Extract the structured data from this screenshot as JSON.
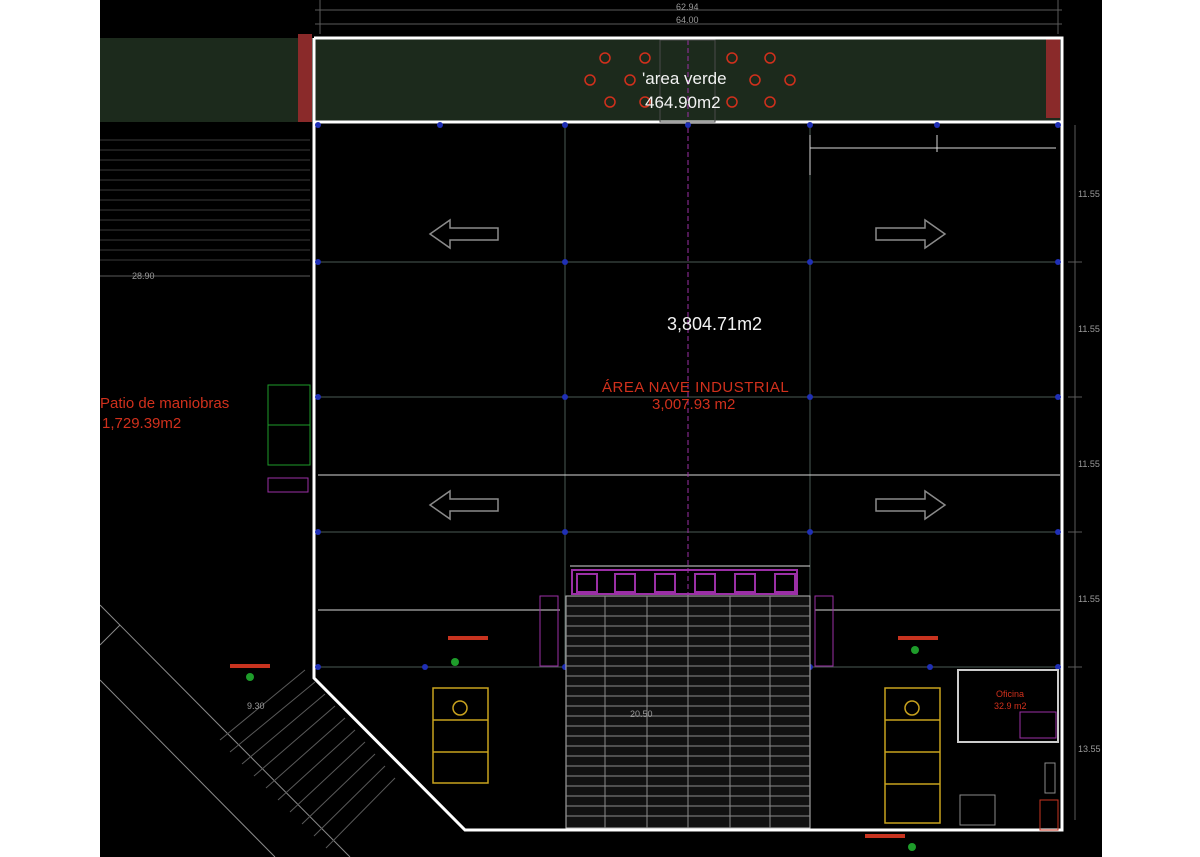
{
  "drawing": {
    "colors": {
      "background": "#000000",
      "boundary": "#ffffff",
      "area_label": "#f2f2f2",
      "annotation": "#d1301c",
      "column_marker": "#1f2fb5",
      "dock_door": "#9b2fa6",
      "grid_line": "#4a5a55",
      "green_strip": "#1c2a1c",
      "brick": "#8a2a2a",
      "dimension_text": "#9a9a9a"
    },
    "labels": {
      "green_area_name": "'area verde",
      "green_area_value": "464.90m2",
      "main_area_value": "3,804.71m2",
      "nave_name": "ÁREA NAVE INDUSTRIAL",
      "nave_value": "3,007.93 m2",
      "patio_name": "Patio de maniobras",
      "patio_value": "1,729.39m2",
      "office_name": "Oficina",
      "office_value": "32.9 m2"
    },
    "dimensions": {
      "top_1": "62.94",
      "top_2": "64.00",
      "left_width": "28.90",
      "bay_1": "11.55",
      "bay_2": "11.55",
      "bay_3": "11.55",
      "bay_4": "11.55",
      "bay_5": "13.55",
      "lower_left": "9.30",
      "dock_width": "20.50"
    },
    "icons": [
      "arrow-left-icon",
      "arrow-right-icon",
      "accessible-parking-icon",
      "tree-icon",
      "compass-icon"
    ]
  }
}
